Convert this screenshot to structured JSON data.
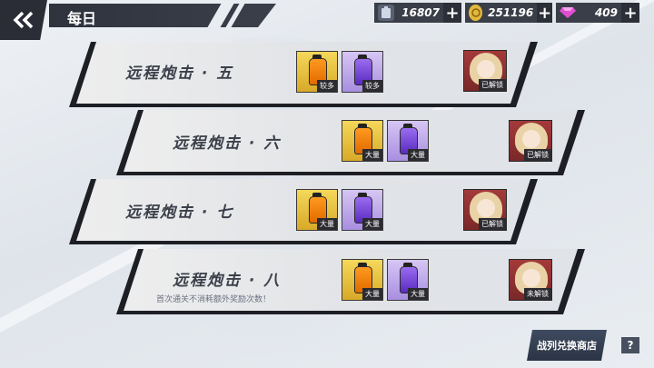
{
  "header": {
    "title": "每日"
  },
  "resources": [
    {
      "icon": "battery-icon",
      "value": "16807"
    },
    {
      "icon": "coin-icon",
      "value": "251196"
    },
    {
      "icon": "gem-icon",
      "value": "409"
    }
  ],
  "stages": [
    {
      "title": "远程炮击 · 五",
      "rewards": [
        {
          "kind": "gold-drink-icon",
          "tag": "较多"
        },
        {
          "kind": "purple-drink-icon",
          "tag": "较多"
        }
      ],
      "unlock_status": "已解锁",
      "hint": ""
    },
    {
      "title": "远程炮击 · 六",
      "rewards": [
        {
          "kind": "gold-drink-icon",
          "tag": "大量"
        },
        {
          "kind": "purple-drink-icon",
          "tag": "大量"
        }
      ],
      "unlock_status": "已解锁",
      "hint": ""
    },
    {
      "title": "远程炮击 · 七",
      "rewards": [
        {
          "kind": "gold-drink-icon",
          "tag": "大量"
        },
        {
          "kind": "purple-drink-icon",
          "tag": "大量"
        }
      ],
      "unlock_status": "已解锁",
      "hint": ""
    },
    {
      "title": "远程炮击 · 八",
      "rewards": [
        {
          "kind": "gold-drink-icon",
          "tag": "大量"
        },
        {
          "kind": "purple-drink-icon",
          "tag": "大量"
        }
      ],
      "unlock_status": "未解锁",
      "hint": "首次通关不消耗额外奖励次数！"
    }
  ],
  "footer": {
    "shop_label": "战列兑换商店",
    "help_label": "?"
  }
}
